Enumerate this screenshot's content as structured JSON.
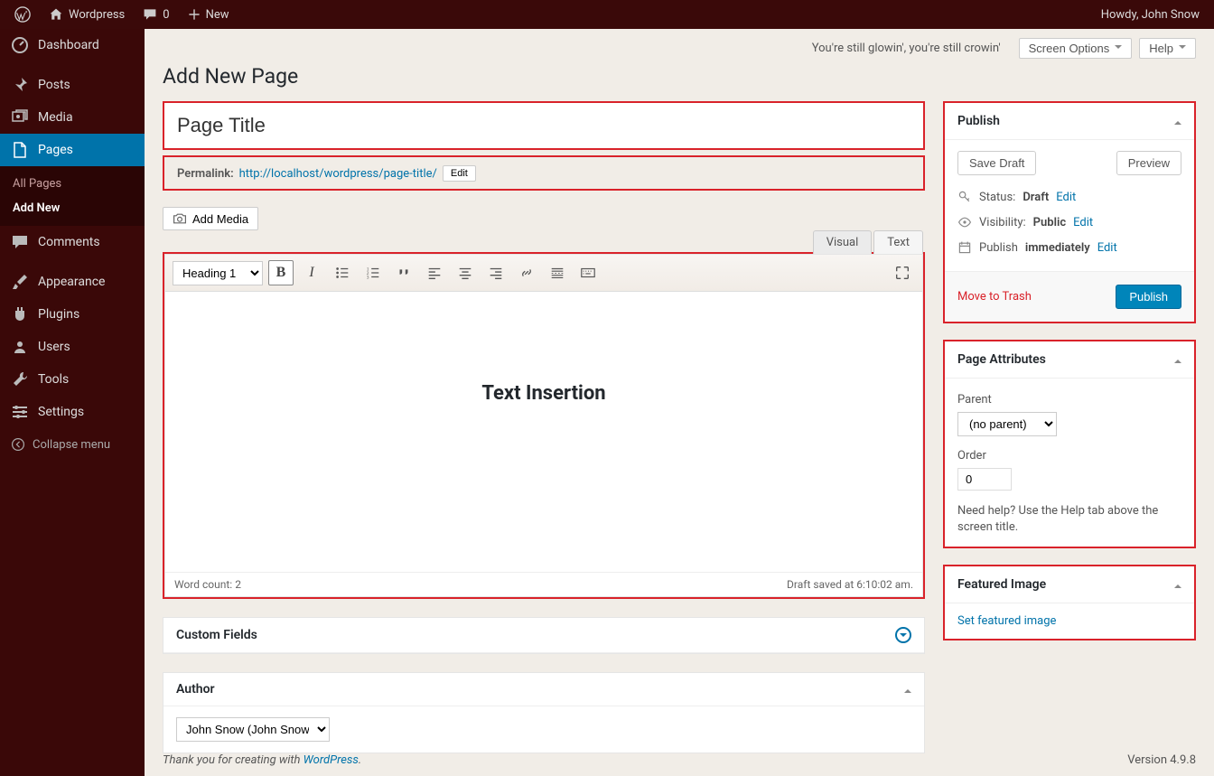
{
  "adminbar": {
    "site_name": "Wordpress",
    "comments_count": "0",
    "new_label": "New",
    "howdy": "Howdy, John Snow"
  },
  "sidebar": {
    "dashboard": "Dashboard",
    "posts": "Posts",
    "media": "Media",
    "pages": "Pages",
    "pages_sub_all": "All Pages",
    "pages_sub_add": "Add New",
    "comments": "Comments",
    "appearance": "Appearance",
    "plugins": "Plugins",
    "users": "Users",
    "tools": "Tools",
    "settings": "Settings",
    "collapse": "Collapse menu"
  },
  "top": {
    "glow_msg": "You're still glowin', you're still crowin'",
    "screen_options": "Screen Options",
    "help": "Help"
  },
  "page": {
    "heading": "Add New Page",
    "title_value": "Page Title",
    "permalink_label": "Permalink:",
    "permalink_url": "http://localhost/wordpress/page-title/",
    "permalink_edit": "Edit",
    "add_media": "Add Media"
  },
  "editor": {
    "tab_visual": "Visual",
    "tab_text": "Text",
    "format_value": "Heading 1",
    "content_heading": "Text Insertion",
    "word_count_label": "Word count:",
    "word_count": "2",
    "draft_saved": "Draft saved at 6:10:02 am."
  },
  "publish": {
    "title": "Publish",
    "save_draft": "Save Draft",
    "preview": "Preview",
    "status_label": "Status:",
    "status_value": "Draft",
    "visibility_label": "Visibility:",
    "visibility_value": "Public",
    "publish_label": "Publish",
    "publish_value": "immediately",
    "edit": "Edit",
    "trash": "Move to Trash",
    "publish_btn": "Publish"
  },
  "attributes": {
    "title": "Page Attributes",
    "parent_label": "Parent",
    "parent_value": "(no parent)",
    "order_label": "Order",
    "order_value": "0",
    "help_text": "Need help? Use the Help tab above the screen title."
  },
  "featured": {
    "title": "Featured Image",
    "link": "Set featured image"
  },
  "custom_fields": {
    "title": "Custom Fields"
  },
  "author": {
    "title": "Author",
    "value": "John Snow (John Snow)"
  },
  "footer": {
    "thanks_pre": "Thank you for creating with ",
    "thanks_link": "WordPress",
    "thanks_post": ".",
    "version": "Version 4.9.8"
  }
}
